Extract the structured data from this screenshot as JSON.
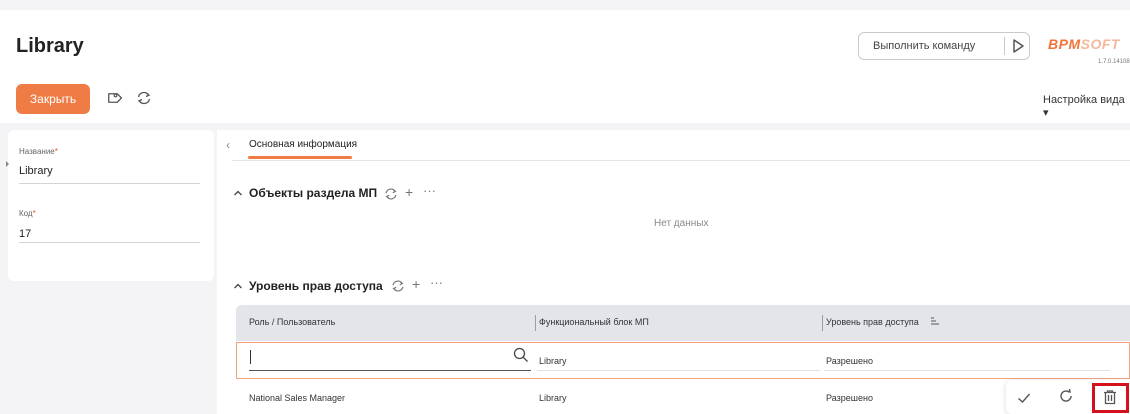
{
  "header": {
    "title": "Library",
    "command_placeholder": "Выполнить команду",
    "logo_main": "ВРМ",
    "logo_soft": "SOFT",
    "version": "1.7.0.14108",
    "close_button": "Закрыть",
    "view_settings": "Настройка вида ▾"
  },
  "form": {
    "name_label": "Название",
    "name_value": "Library",
    "code_label": "Код",
    "code_value": "17",
    "required_mark": "*"
  },
  "tabs": [
    {
      "label": "Основная информация",
      "active": true
    }
  ],
  "sections": {
    "objects": {
      "title": "Объекты раздела МП",
      "empty_text": "Нет данных"
    },
    "access": {
      "title": "Уровень прав доступа"
    }
  },
  "grid": {
    "columns": [
      "Роль / Пользователь",
      "Функциональный блок МП",
      "Уровень прав доступа"
    ],
    "edit_row": {
      "role": "",
      "block": "Library",
      "level": "Разрешено"
    },
    "rows": [
      {
        "role": "National Sales Manager",
        "block": "Library",
        "level": "Разрешено"
      }
    ]
  },
  "icons": {
    "tag": "tag-icon",
    "sync": "sync-icon",
    "add": "plus-icon",
    "more": "more-dots-icon",
    "search": "search-icon",
    "confirm": "check-icon",
    "refresh": "refresh-icon",
    "delete": "trash-icon"
  },
  "colors": {
    "accent": "#f07c45",
    "highlight": "#d4121b",
    "grid_header": "#e3e5ea"
  }
}
